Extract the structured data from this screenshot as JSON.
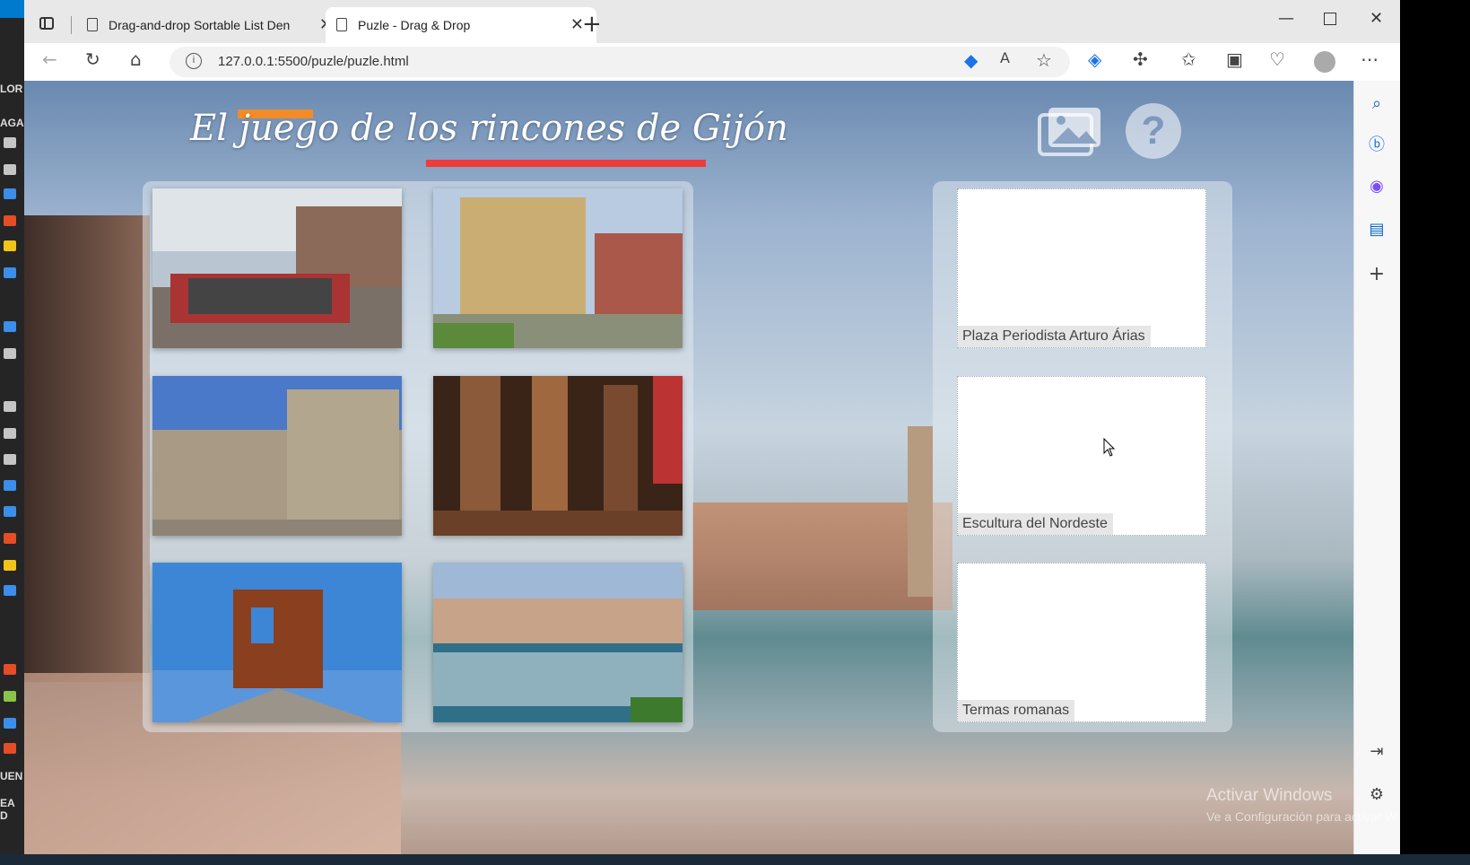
{
  "editor_strip": {
    "labels": [
      "LOR",
      "AGA",
      "UEN",
      "EA D"
    ]
  },
  "browser": {
    "tabs": [
      {
        "title": "Drag-and-drop Sortable List Den",
        "active": false
      },
      {
        "title": "Puzle - Drag & Drop",
        "active": true
      }
    ],
    "address": "127.0.0.1:5500/puzle/puzle.html"
  },
  "page": {
    "title": "El juego de los rincones de Gijón",
    "accent_colors": {
      "orange": "#f28c28",
      "red": "#ee3b3b"
    },
    "icons": {
      "gallery": "image-gallery-icon",
      "help": "help-icon"
    },
    "help_symbol": "?",
    "photos": [
      {
        "alt": "Crowd on street terrace"
      },
      {
        "alt": "Plaza with yellow building"
      },
      {
        "alt": "Stone palace with trees"
      },
      {
        "alt": "Roman baths columns"
      },
      {
        "alt": "Rust sculpture against sky"
      },
      {
        "alt": "Marina with boats"
      }
    ],
    "slots": [
      {
        "label": "Plaza Periodista Arturo Árias"
      },
      {
        "label": "Escultura del Nordeste"
      },
      {
        "label": "Termas romanas"
      }
    ]
  },
  "watermark": {
    "line1": "Activar Windows",
    "line2": "Ve a Configuración para activar W"
  }
}
